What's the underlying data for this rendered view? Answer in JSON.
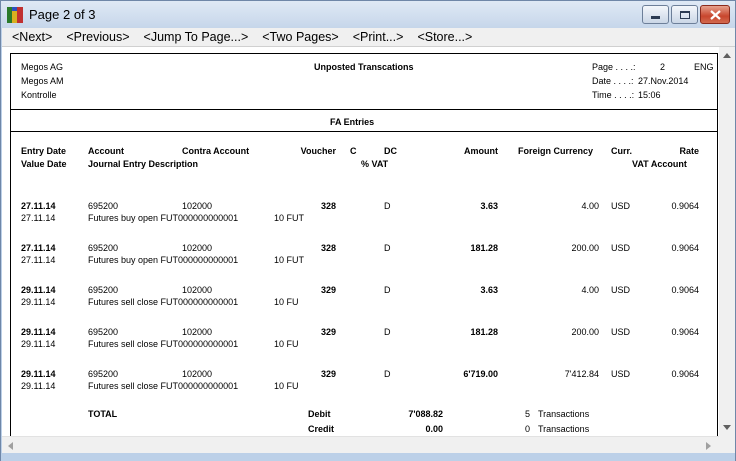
{
  "window": {
    "title": "Page 2 of 3"
  },
  "menu": [
    "<Next>",
    "<Previous>",
    "<Jump To Page...>",
    "<Two Pages>",
    "<Print...>",
    "<Store...>"
  ],
  "report": {
    "company_lines": [
      "Megos AG",
      "Megos AM",
      "Kontrolle"
    ],
    "title": "Unposted Transcations",
    "page_label": "Page . . . .:",
    "page_value": "2",
    "language": "ENG",
    "date_label": "Date . . . .:",
    "date_value": "27.Nov.2014",
    "time_label": "Time . . . .:",
    "time_value": "15:06",
    "section_title": "FA Entries",
    "columns": {
      "entry_date": "Entry Date",
      "value_date": "Value Date",
      "account": "Account",
      "journal_desc": "Journal Entry Description",
      "contra_account": "Contra Account",
      "voucher": "Voucher",
      "c": "C",
      "dc": "DC",
      "vat_pct": "% VAT",
      "amount": "Amount",
      "foreign_currency": "Foreign Currency",
      "curr": "Curr.",
      "rate": "Rate",
      "vat_account": "VAT Account"
    },
    "entries": [
      {
        "entry_date": "27.11.14",
        "value_date": "27.11.14",
        "account": "695200",
        "contra": "102000",
        "voucher": "328",
        "dc": "D",
        "amount": "3.63",
        "foreign": "4.00",
        "curr": "USD",
        "rate": "0.9064",
        "desc": "Futures buy open FUT000000000001",
        "vat": "10 FUT"
      },
      {
        "entry_date": "27.11.14",
        "value_date": "27.11.14",
        "account": "695200",
        "contra": "102000",
        "voucher": "328",
        "dc": "D",
        "amount": "181.28",
        "foreign": "200.00",
        "curr": "USD",
        "rate": "0.9064",
        "desc": "Futures buy open FUT000000000001",
        "vat": "10 FUT"
      },
      {
        "entry_date": "29.11.14",
        "value_date": "29.11.14",
        "account": "695200",
        "contra": "102000",
        "voucher": "329",
        "dc": "D",
        "amount": "3.63",
        "foreign": "4.00",
        "curr": "USD",
        "rate": "0.9064",
        "desc": "Futures sell close FUT000000000001",
        "vat": "10 FU"
      },
      {
        "entry_date": "29.11.14",
        "value_date": "29.11.14",
        "account": "695200",
        "contra": "102000",
        "voucher": "329",
        "dc": "D",
        "amount": "181.28",
        "foreign": "200.00",
        "curr": "USD",
        "rate": "0.9064",
        "desc": "Futures sell close FUT000000000001",
        "vat": "10 FU"
      },
      {
        "entry_date": "29.11.14",
        "value_date": "29.11.14",
        "account": "695200",
        "contra": "102000",
        "voucher": "329",
        "dc": "D",
        "amount": "6'719.00",
        "foreign": "7'412.84",
        "curr": "USD",
        "rate": "0.9064",
        "desc": "Futures sell close FUT000000000001",
        "vat": "10 FU"
      }
    ],
    "total": {
      "label": "TOTAL",
      "debit_label": "Debit",
      "debit_value": "7'088.82",
      "debit_count": "5",
      "debit_tx": "Transactions",
      "credit_label": "Credit",
      "credit_value": "0.00",
      "credit_count": "0",
      "credit_tx": "Transactions"
    }
  },
  "colors": {
    "title_bar": "#c6d6ea",
    "close_button": "#c8462d",
    "page_bg": "#ffffff"
  },
  "icons": [
    "app-icon",
    "minimize-icon",
    "maximize-icon",
    "close-icon",
    "scroll-up-icon",
    "scroll-down-icon",
    "scroll-left-icon",
    "scroll-right-icon"
  ]
}
